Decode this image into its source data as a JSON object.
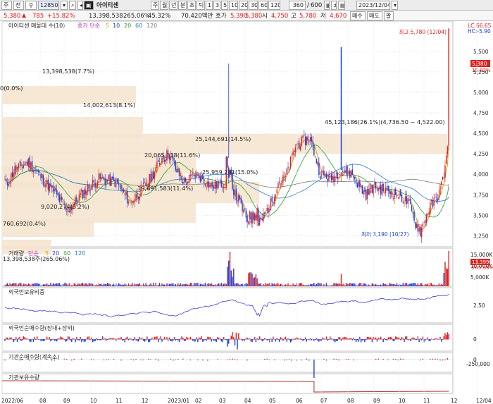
{
  "toolbar": {
    "screen_no": "주",
    "mode": "전",
    "code": "128500",
    "name": "아이티센",
    "periods": [
      "주",
      "월",
      "년",
      "분",
      "초",
      "틱"
    ],
    "intervals": [
      "1",
      "3",
      "5",
      "10",
      "20",
      "30",
      "60",
      "120"
    ],
    "count": "360",
    "count_total": "600",
    "date": "2023/12/04",
    "buy": "매수",
    "sell": "매도",
    "menu": "팔"
  },
  "quote": {
    "price": "5,380",
    "change": "785",
    "rate": "+15.82%",
    "volume": "13,398,538",
    "volume_ratio": "265.06%",
    "turnover_rate": "45.32%",
    "amount": "70,420백만",
    "ask_label": "호가",
    "ask": "5,390",
    "bid": "5,380",
    "open_label": "시",
    "open": "4,750",
    "high_label": "고",
    "high": "5,780",
    "low_label": "저",
    "low": "4,670"
  },
  "price_panel": {
    "legend": "아이티센 매물대 수(10)",
    "ma_label": "종가 단순",
    "ma_periods": [
      "5",
      "10",
      "20",
      "60",
      "120"
    ],
    "high_note": "최고 5,780 (12/04)",
    "low_note": "최저 3,190 (10/27)",
    "lc": "LC:66.65",
    "hc": "HC:-5.90",
    "current_badge": "5,380",
    "current_rate": "15.82%",
    "yticks": [
      "5,500",
      "5,250",
      "5,000",
      "4,750",
      "4,500",
      "4,250",
      "4,000",
      "3,750",
      "3,500",
      "3,250"
    ],
    "profile_labels": [
      "13,398,538(7.7%)",
      "0(0.0%)",
      "14,002,613(8.1%)",
      "25,144,691(14.5%)",
      "20,065,318(11.6%)",
      "25,959,281(15.0%)",
      "19,691,583(11.4%)",
      "45,123,186(26.1%)(4,736.50 ~ 4,522.00)",
      "9,020,274(5.2%)",
      "760,692(0.4%)"
    ]
  },
  "volume_panel": {
    "legend": "거래량",
    "ma_label": "단순",
    "ma_periods": [
      "5",
      "20",
      "60",
      "120"
    ],
    "value": "13,398,538주(265.06%)",
    "badge": "13,399K",
    "badge2": "265.06%",
    "yticks": [
      "15,000K",
      "10,000K",
      "5,000K"
    ]
  },
  "foreign_panel": {
    "legend": "외국인보유비중",
    "ytick": "2.50"
  },
  "foreign_net_panel": {
    "legend": "외국인순매수량(장내+장외)",
    "ytick": "0"
  },
  "inst_net_panel": {
    "legend": "기관순매수량(계속소)",
    "yticks": [
      "0",
      "-250,000"
    ]
  },
  "inst_hold_panel": {
    "legend": "기관보유수량"
  },
  "xaxis": [
    "2022/06",
    "08",
    "09",
    "10",
    "11",
    "12",
    "2023/01",
    "02",
    "03",
    "04",
    "05",
    "06",
    "07",
    "08",
    "09",
    "10",
    "11",
    "12",
    "12/04"
  ],
  "colors": {
    "up": "#e0201c",
    "down": "#1c3ee0",
    "ma5": "#e0a000",
    "ma20": "#2a9a2a",
    "ma120": "#7a7a7a",
    "profile": "#f5e4cc"
  }
}
